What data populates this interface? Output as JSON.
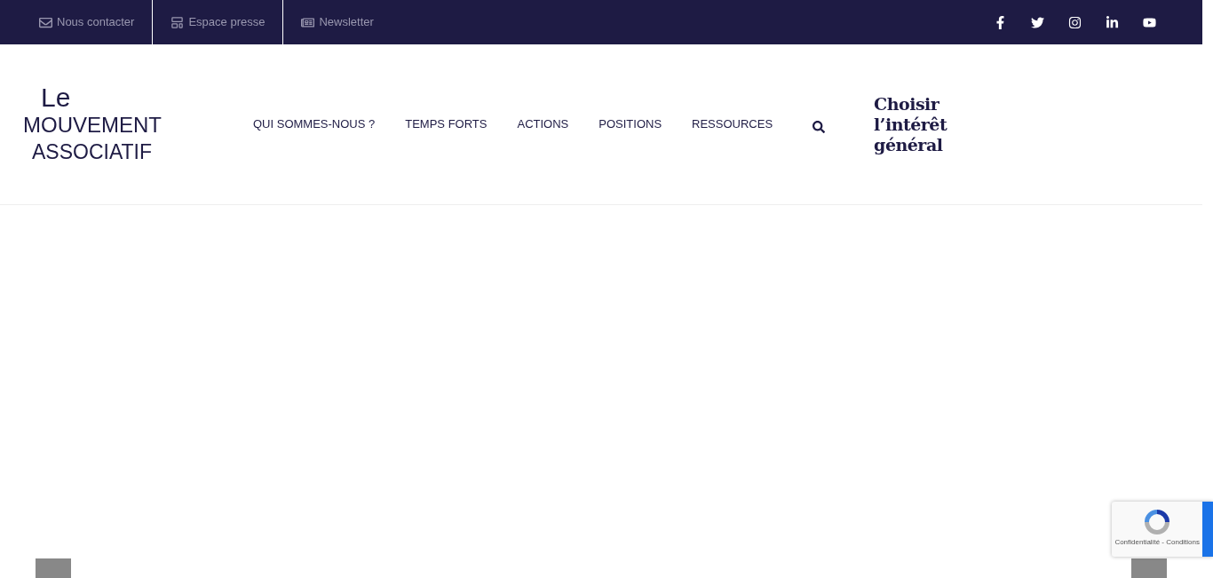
{
  "top_links": [
    {
      "kind": "mail",
      "label": "Nous contacter"
    },
    {
      "kind": "layout",
      "label": "Espace presse"
    },
    {
      "kind": "newspaper",
      "label": "Newsletter"
    }
  ],
  "social": [
    {
      "kind": "facebook"
    },
    {
      "kind": "twitter"
    },
    {
      "kind": "instagram"
    },
    {
      "kind": "linkedin"
    },
    {
      "kind": "youtube"
    }
  ],
  "logo": {
    "lines": [
      "Le",
      "MOUVEMENT",
      "ASSOCIATIF"
    ]
  },
  "nav": [
    "QUI SOMMES-NOUS ?",
    "TEMPS FORTS",
    "ACTIONS",
    "POSITIONS",
    "RESSOURCES"
  ],
  "campaign": {
    "lines": [
      "Choisir",
      "l’intérêt",
      "général"
    ]
  },
  "recaptcha": {
    "links": "Confidentialité - Conditions"
  }
}
